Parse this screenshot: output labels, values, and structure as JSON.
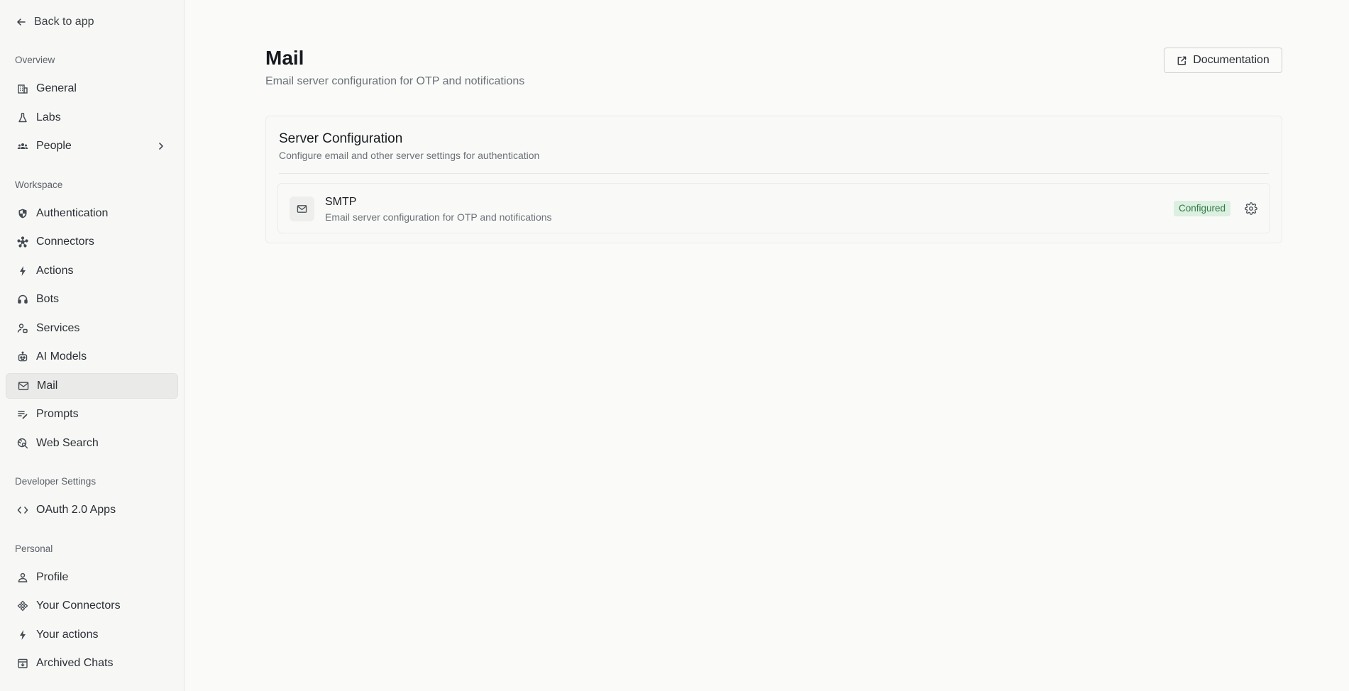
{
  "sidebar": {
    "back_label": "Back to app",
    "sections": {
      "overview": "Overview",
      "workspace": "Workspace",
      "developer": "Developer Settings",
      "personal": "Personal"
    },
    "items": {
      "general": "General",
      "labs": "Labs",
      "people": "People",
      "authentication": "Authentication",
      "connectors": "Connectors",
      "actions": "Actions",
      "bots": "Bots",
      "services": "Services",
      "ai_models": "AI Models",
      "mail": "Mail",
      "prompts": "Prompts",
      "web_search": "Web Search",
      "oauth_apps": "OAuth 2.0 Apps",
      "profile": "Profile",
      "your_connectors": "Your Connectors",
      "your_actions": "Your actions",
      "archived_chats": "Archived Chats"
    },
    "active_item": "mail"
  },
  "header": {
    "title": "Mail",
    "subtitle": "Email server configuration for OTP and notifications",
    "doc_button": "Documentation"
  },
  "card": {
    "title": "Server Configuration",
    "subtitle": "Configure email and other server settings for authentication",
    "smtp": {
      "title": "SMTP",
      "description": "Email server configuration for OTP and notifications",
      "status": "Configured"
    }
  },
  "colors": {
    "status_bg": "#dcefe1",
    "status_text": "#2f7a44",
    "active_bg": "#eaebe8"
  }
}
